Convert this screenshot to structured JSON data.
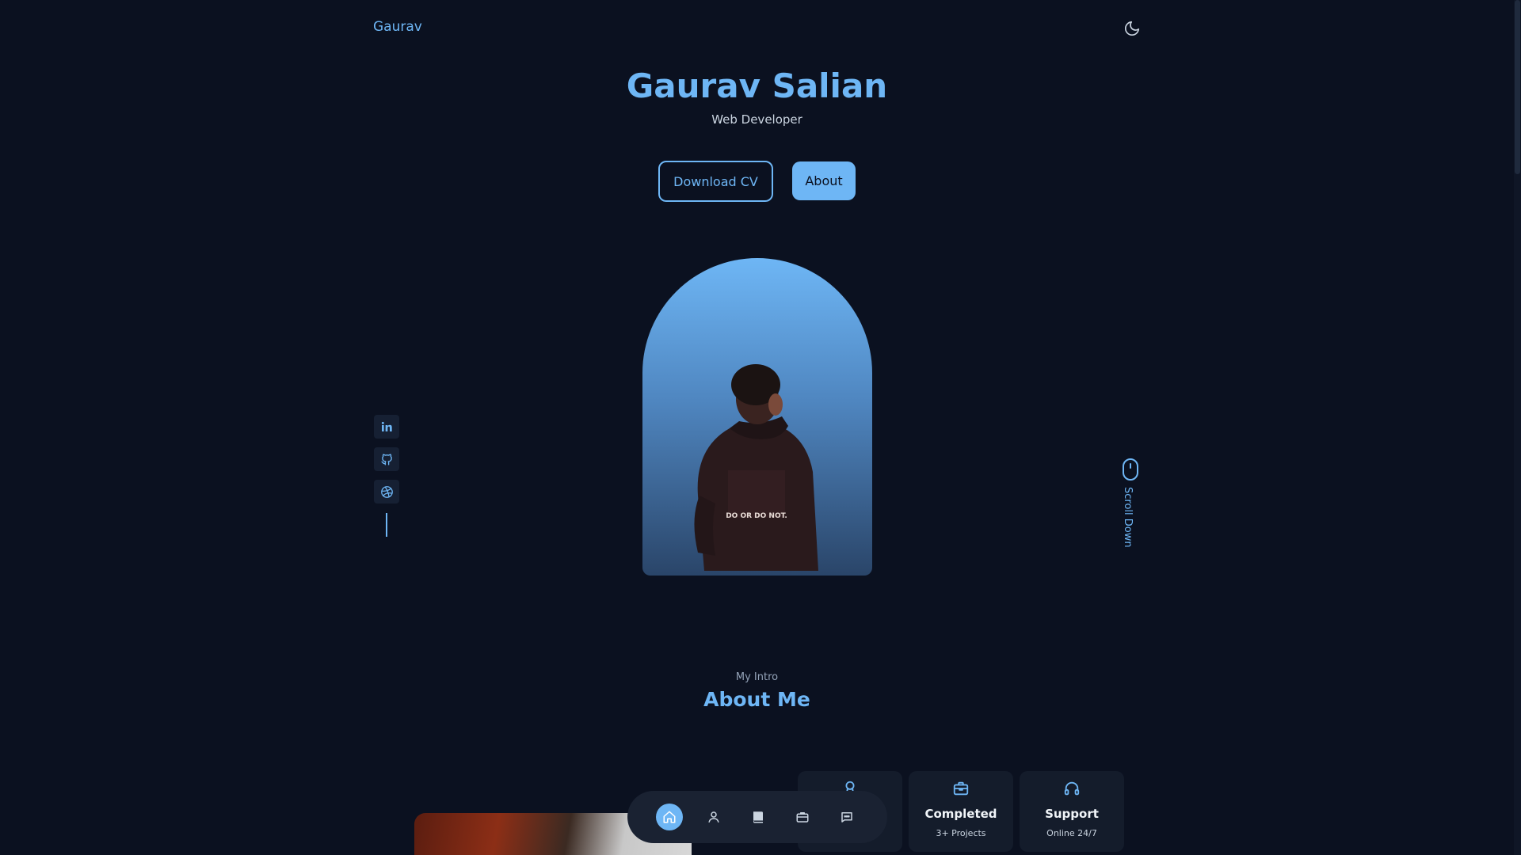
{
  "header": {
    "logo": "Gaurav",
    "theme_icon": "moon-icon"
  },
  "hero": {
    "name": "Gaurav Salian",
    "role": "Web Developer",
    "download_label": "Download CV",
    "about_label": "About",
    "hoodie_text": "DO OR DO NOT."
  },
  "socials": [
    {
      "name": "linkedin-icon"
    },
    {
      "name": "github-icon"
    },
    {
      "name": "dribbble-icon"
    }
  ],
  "scroll": {
    "label": "Scroll Down",
    "icon": "mouse-icon"
  },
  "about": {
    "subtitle": "My Intro",
    "title": "About Me",
    "cards": [
      {
        "icon": "award-icon",
        "title": "",
        "subtitle": ""
      },
      {
        "icon": "briefcase-icon",
        "title": "Completed",
        "subtitle": "3+ Projects"
      },
      {
        "icon": "headset-icon",
        "title": "Support",
        "subtitle": "Online 24/7"
      }
    ]
  },
  "bottom_nav": [
    {
      "icon": "home-icon",
      "active": true
    },
    {
      "icon": "user-icon",
      "active": false
    },
    {
      "icon": "book-icon",
      "active": false
    },
    {
      "icon": "briefcase-icon",
      "active": false
    },
    {
      "icon": "chat-icon",
      "active": false
    }
  ],
  "colors": {
    "background": "#0b1120",
    "accent": "#6eb6f5",
    "card": "#141c2b"
  }
}
